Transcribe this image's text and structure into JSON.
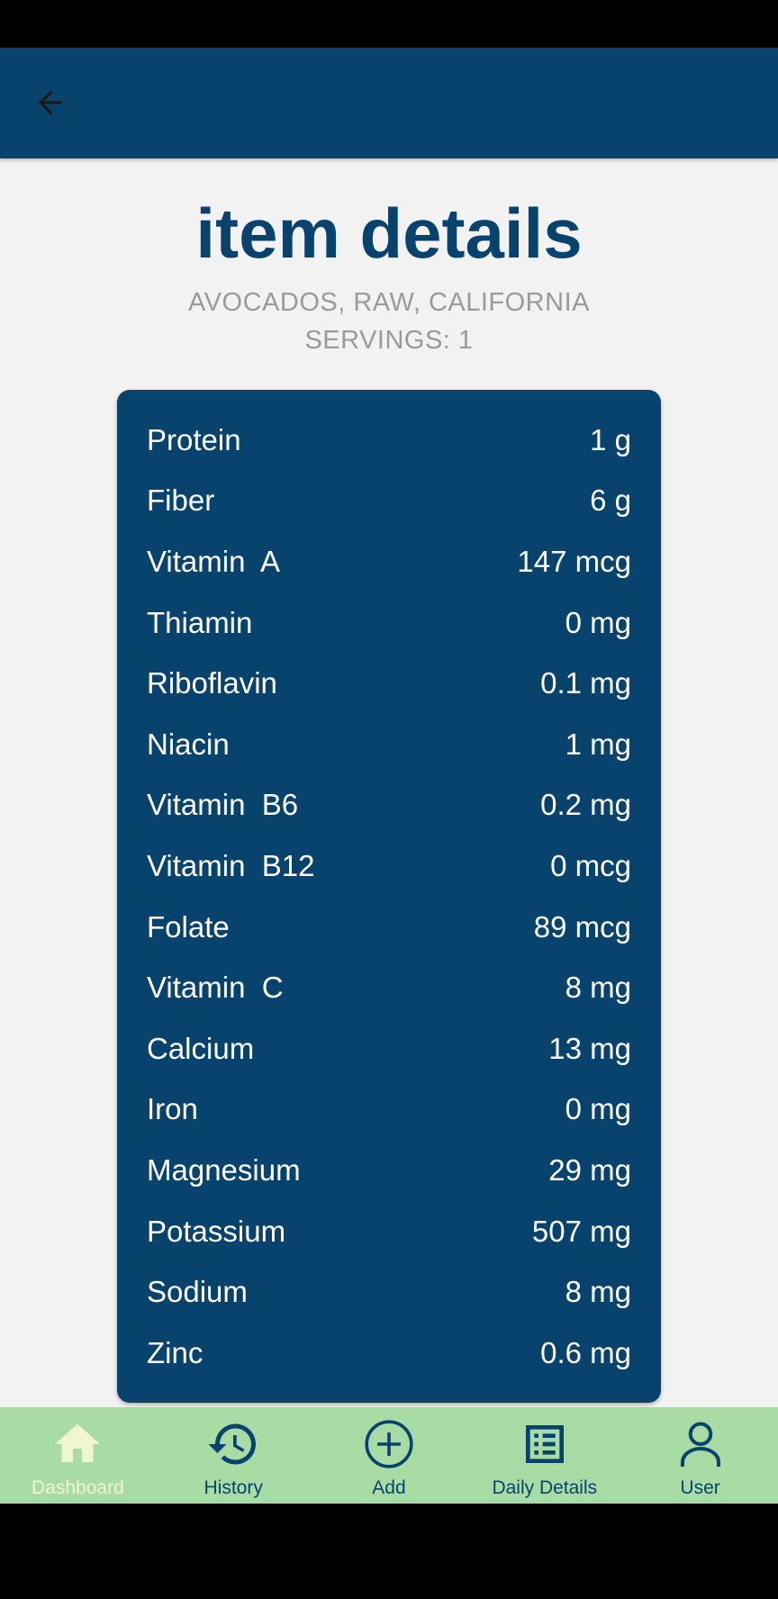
{
  "header": {
    "back_icon": "arrow-left-icon"
  },
  "page": {
    "title": "item details",
    "item_name": "AVOCADOS, RAW, CALIFORNIA",
    "servings": "SERVINGS: 1"
  },
  "nutrients": [
    {
      "name": "Protein",
      "value": "1 g"
    },
    {
      "name": "Fiber",
      "value": "6 g"
    },
    {
      "name": "Vitamin  A",
      "value": "147 mcg"
    },
    {
      "name": "Thiamin",
      "value": "0 mg"
    },
    {
      "name": "Riboflavin",
      "value": "0.1 mg"
    },
    {
      "name": "Niacin",
      "value": "1 mg"
    },
    {
      "name": "Vitamin  B6",
      "value": "0.2 mg"
    },
    {
      "name": "Vitamin  B12",
      "value": "0 mcg"
    },
    {
      "name": "Folate",
      "value": "89 mcg"
    },
    {
      "name": "Vitamin  C",
      "value": "8 mg"
    },
    {
      "name": "Calcium",
      "value": "13 mg"
    },
    {
      "name": "Iron",
      "value": "0 mg"
    },
    {
      "name": "Magnesium",
      "value": "29 mg"
    },
    {
      "name": "Potassium",
      "value": "507 mg"
    },
    {
      "name": "Sodium",
      "value": "8 mg"
    },
    {
      "name": "Zinc",
      "value": "0.6 mg"
    }
  ],
  "bottom_nav": {
    "items": [
      {
        "label": "Dashboard",
        "icon": "home-icon",
        "active": true
      },
      {
        "label": "History",
        "icon": "history-icon",
        "active": false
      },
      {
        "label": "Add",
        "icon": "add-circle-icon",
        "active": false
      },
      {
        "label": "Daily Details",
        "icon": "list-icon",
        "active": false
      },
      {
        "label": "User",
        "icon": "user-icon",
        "active": false
      }
    ]
  },
  "colors": {
    "primary": "#08436e",
    "background": "#f2f2f2",
    "nav_background": "#a9dba4",
    "nav_active": "#f0f7cf",
    "subtitle": "#9a9a9a"
  }
}
